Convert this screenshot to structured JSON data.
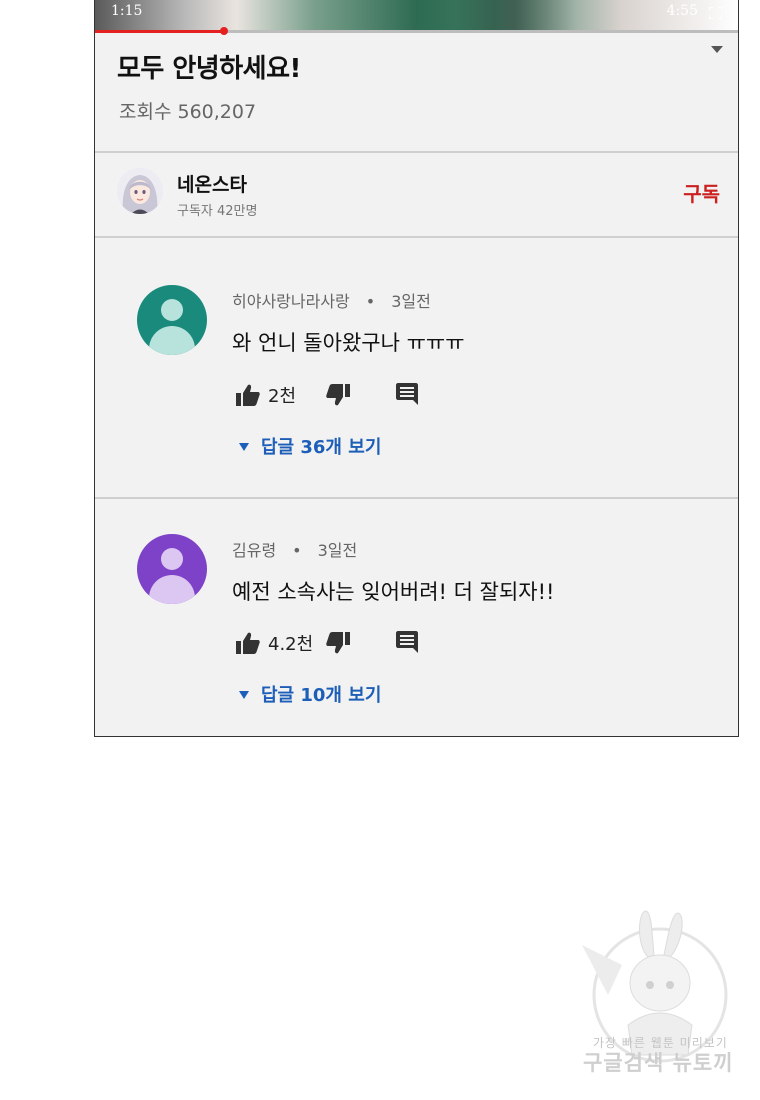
{
  "player": {
    "current_time": "1:15",
    "total_time": "4:55",
    "progress": 0.2
  },
  "video": {
    "title": "모두 안녕하세요!",
    "views": "조회수 560,207"
  },
  "channel": {
    "name": "네온스타",
    "subscribers": "구독자 42만명",
    "subscribe_label": "구독"
  },
  "comments": [
    {
      "author": "히야사랑나라사랑",
      "separator": "•",
      "time": "3일전",
      "text": "와 언니 돌아왔구나 ㅠㅠㅠ",
      "likes": "2천",
      "replies": "답글 36개 보기",
      "avatar_color": "#1a8a7c",
      "avatar_light": "#b7e3dc"
    },
    {
      "author": "김유령",
      "separator": "•",
      "time": "3일전",
      "text": "예전 소속사는 잊어버려! 더 잘되자!!",
      "likes": "4.2천",
      "replies": "답글 10개 보기",
      "avatar_color": "#7d42c7",
      "avatar_light": "#dcc7f2"
    }
  ],
  "watermark": {
    "line1": "가장 빠른 웹툰 미리보기",
    "line2": "구글검색 뉴토끼"
  },
  "colors": {
    "accent_red": "#cc1f1f",
    "link_blue": "#1d5fb8",
    "panel_bg": "#f2f2f2"
  }
}
